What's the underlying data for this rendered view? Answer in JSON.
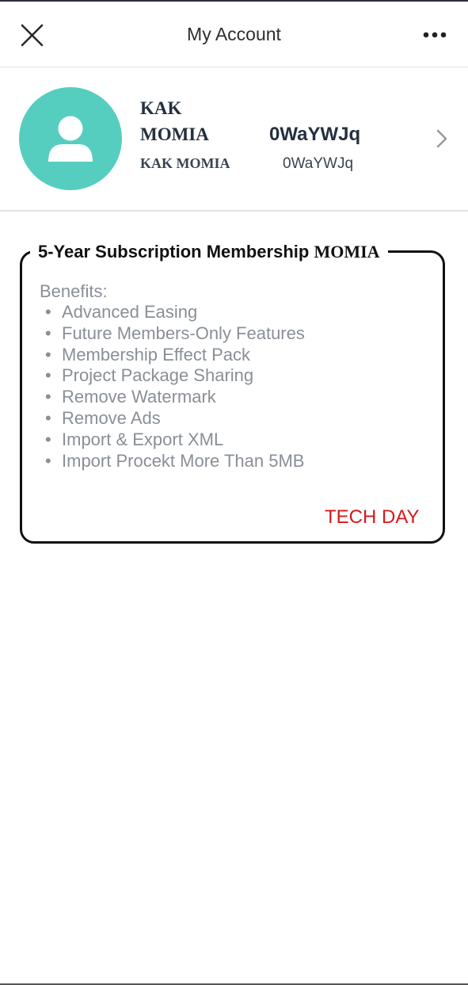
{
  "header": {
    "title": "My Account",
    "close_icon": "close-icon",
    "more_icon": "more-horizontal-icon"
  },
  "profile": {
    "avatar_icon": "user-avatar-icon",
    "avatar_color": "#56cebf",
    "name_line1": "KAK",
    "name_line2": "MOMIA",
    "id_large": "0WaYWJq",
    "name_small": "KAK MOMIA",
    "id_small": "0WaYWJq",
    "chevron_icon": "chevron-right-icon"
  },
  "subscription": {
    "title_main": "5-Year Subscription Membership ",
    "title_brand": "MOMIA",
    "benefits_label": "Benefits:",
    "benefits": [
      "Advanced Easing",
      "Future Members-Only Features",
      "Membership Effect Pack",
      "Project Package Sharing",
      "Remove Watermark",
      "Remove Ads",
      "Import & Export XML",
      "Import Procekt More Than 5MB"
    ],
    "bullet": "•",
    "action_label": "TECH DAY",
    "action_color": "#d8171b"
  }
}
